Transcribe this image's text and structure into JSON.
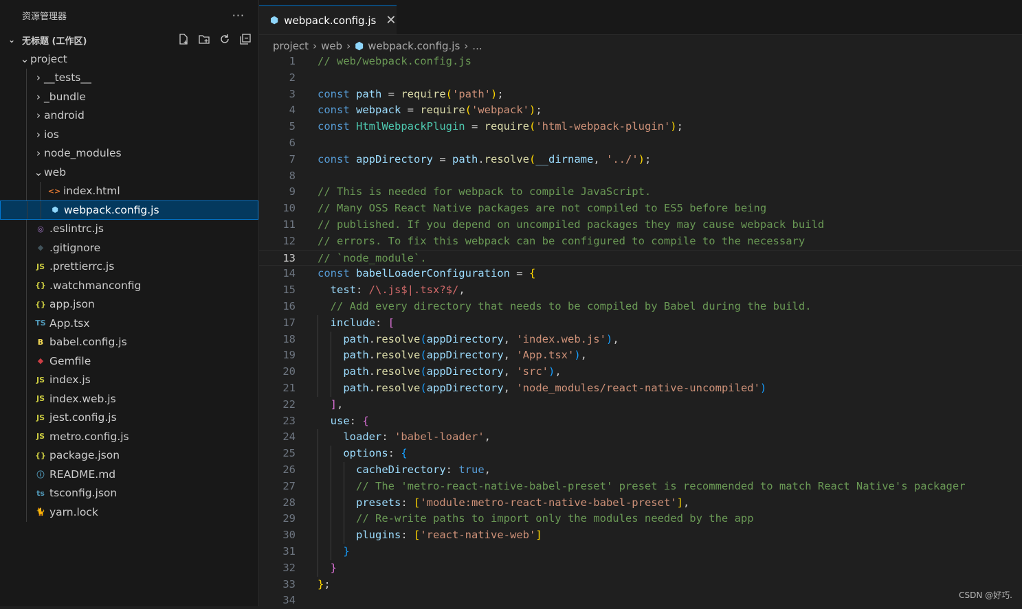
{
  "explorer": {
    "title": "资源管理器",
    "more": "···",
    "workspace": "无标题 (工作区)",
    "tree": [
      {
        "label": "project",
        "depth": 0,
        "type": "folder",
        "open": true,
        "icon": "chevron"
      },
      {
        "label": "__tests__",
        "depth": 1,
        "type": "folder",
        "open": false
      },
      {
        "label": "_bundle",
        "depth": 1,
        "type": "folder",
        "open": false
      },
      {
        "label": "android",
        "depth": 1,
        "type": "folder",
        "open": false
      },
      {
        "label": "ios",
        "depth": 1,
        "type": "folder",
        "open": false
      },
      {
        "label": "node_modules",
        "depth": 1,
        "type": "folder",
        "open": false
      },
      {
        "label": "web",
        "depth": 1,
        "type": "folder",
        "open": true
      },
      {
        "label": "index.html",
        "depth": 2,
        "type": "file",
        "icon": "html-icon",
        "glyph": "<>",
        "color": "#e37933"
      },
      {
        "label": "webpack.config.js",
        "depth": 2,
        "type": "file",
        "icon": "webpack-icon",
        "glyph": "⬢",
        "color": "#8ed6fb",
        "selected": true
      },
      {
        "label": ".eslintrc.js",
        "depth": 1,
        "type": "file",
        "icon": "eslint-icon",
        "glyph": "◎",
        "color": "#a074c4"
      },
      {
        "label": ".gitignore",
        "depth": 1,
        "type": "file",
        "icon": "git-icon",
        "glyph": "◆",
        "color": "#41535b"
      },
      {
        "label": ".prettierrc.js",
        "depth": 1,
        "type": "file",
        "icon": "js-icon",
        "glyph": "JS",
        "color": "#cbcb41"
      },
      {
        "label": ".watchmanconfig",
        "depth": 1,
        "type": "file",
        "icon": "json-icon",
        "glyph": "{}",
        "color": "#cbcb41"
      },
      {
        "label": "app.json",
        "depth": 1,
        "type": "file",
        "icon": "json-icon",
        "glyph": "{}",
        "color": "#cbcb41"
      },
      {
        "label": "App.tsx",
        "depth": 1,
        "type": "file",
        "icon": "ts-icon",
        "glyph": "TS",
        "color": "#519aba"
      },
      {
        "label": "babel.config.js",
        "depth": 1,
        "type": "file",
        "icon": "babel-icon",
        "glyph": "B",
        "color": "#f5da55"
      },
      {
        "label": "Gemfile",
        "depth": 1,
        "type": "file",
        "icon": "ruby-icon",
        "glyph": "◆",
        "color": "#cc3e44"
      },
      {
        "label": "index.js",
        "depth": 1,
        "type": "file",
        "icon": "js-icon",
        "glyph": "JS",
        "color": "#cbcb41"
      },
      {
        "label": "index.web.js",
        "depth": 1,
        "type": "file",
        "icon": "js-icon",
        "glyph": "JS",
        "color": "#cbcb41"
      },
      {
        "label": "jest.config.js",
        "depth": 1,
        "type": "file",
        "icon": "js-icon",
        "glyph": "JS",
        "color": "#cbcb41"
      },
      {
        "label": "metro.config.js",
        "depth": 1,
        "type": "file",
        "icon": "js-icon",
        "glyph": "JS",
        "color": "#cbcb41"
      },
      {
        "label": "package.json",
        "depth": 1,
        "type": "file",
        "icon": "json-icon",
        "glyph": "{}",
        "color": "#cbcb41"
      },
      {
        "label": "README.md",
        "depth": 1,
        "type": "file",
        "icon": "info-icon",
        "glyph": "ⓘ",
        "color": "#519aba"
      },
      {
        "label": "tsconfig.json",
        "depth": 1,
        "type": "file",
        "icon": "tsconfig-icon",
        "glyph": "ts",
        "color": "#519aba"
      },
      {
        "label": "yarn.lock",
        "depth": 1,
        "type": "file",
        "icon": "yarn-icon",
        "glyph": "🐈",
        "color": "#519aba"
      }
    ]
  },
  "tab": {
    "label": "webpack.config.js",
    "close": "✕"
  },
  "breadcrumb": [
    "project",
    "web",
    "webpack.config.js",
    "..."
  ],
  "editor": {
    "active_line": 13,
    "lines": [
      [
        [
          "c",
          "// web/webpack.config.js"
        ]
      ],
      [],
      [
        [
          "k",
          "const "
        ],
        [
          "v",
          "path"
        ],
        [
          "p",
          " = "
        ],
        [
          "f",
          "require"
        ],
        [
          "b1",
          "("
        ],
        [
          "s",
          "'path'"
        ],
        [
          "b1",
          ")"
        ],
        [
          "p",
          ";"
        ]
      ],
      [
        [
          "k",
          "const "
        ],
        [
          "v",
          "webpack"
        ],
        [
          "p",
          " = "
        ],
        [
          "f",
          "require"
        ],
        [
          "b1",
          "("
        ],
        [
          "s",
          "'webpack'"
        ],
        [
          "b1",
          ")"
        ],
        [
          "p",
          ";"
        ]
      ],
      [
        [
          "k",
          "const "
        ],
        [
          "cl",
          "HtmlWebpackPlugin"
        ],
        [
          "p",
          " = "
        ],
        [
          "f",
          "require"
        ],
        [
          "b1",
          "("
        ],
        [
          "s",
          "'html-webpack-plugin'"
        ],
        [
          "b1",
          ")"
        ],
        [
          "p",
          ";"
        ]
      ],
      [],
      [
        [
          "k",
          "const "
        ],
        [
          "v",
          "appDirectory"
        ],
        [
          "p",
          " = "
        ],
        [
          "v",
          "path"
        ],
        [
          "p",
          "."
        ],
        [
          "f",
          "resolve"
        ],
        [
          "b1",
          "("
        ],
        [
          "v",
          "__dirname"
        ],
        [
          "p",
          ", "
        ],
        [
          "s",
          "'../'"
        ],
        [
          "b1",
          ")"
        ],
        [
          "p",
          ";"
        ]
      ],
      [],
      [
        [
          "c",
          "// This is needed for webpack to compile JavaScript."
        ]
      ],
      [
        [
          "c",
          "// Many OSS React Native packages are not compiled to ES5 before being"
        ]
      ],
      [
        [
          "c",
          "// published. If you depend on uncompiled packages they may cause webpack build"
        ]
      ],
      [
        [
          "c",
          "// errors. To fix this webpack can be configured to compile to the necessary"
        ]
      ],
      [
        [
          "c",
          "// `node_module`."
        ]
      ],
      [
        [
          "k",
          "const "
        ],
        [
          "v",
          "babelLoaderConfiguration"
        ],
        [
          "p",
          " = "
        ],
        [
          "b1",
          "{"
        ]
      ],
      [
        [
          "p",
          "  "
        ],
        [
          "pr",
          "test"
        ],
        [
          "p",
          ": "
        ],
        [
          "r",
          "/\\.js$|.tsx?$/"
        ],
        [
          "p",
          ","
        ]
      ],
      [
        [
          "p",
          "  "
        ],
        [
          "c",
          "// Add every directory that needs to be compiled by Babel during the build."
        ]
      ],
      [
        [
          "p",
          "  "
        ],
        [
          "pr",
          "include"
        ],
        [
          "p",
          ": "
        ],
        [
          "b2",
          "["
        ]
      ],
      [
        [
          "p",
          "    "
        ],
        [
          "v",
          "path"
        ],
        [
          "p",
          "."
        ],
        [
          "f",
          "resolve"
        ],
        [
          "b3",
          "("
        ],
        [
          "v",
          "appDirectory"
        ],
        [
          "p",
          ", "
        ],
        [
          "s",
          "'index.web.js'"
        ],
        [
          "b3",
          ")"
        ],
        [
          "p",
          ","
        ]
      ],
      [
        [
          "p",
          "    "
        ],
        [
          "v",
          "path"
        ],
        [
          "p",
          "."
        ],
        [
          "f",
          "resolve"
        ],
        [
          "b3",
          "("
        ],
        [
          "v",
          "appDirectory"
        ],
        [
          "p",
          ", "
        ],
        [
          "s",
          "'App.tsx'"
        ],
        [
          "b3",
          ")"
        ],
        [
          "p",
          ","
        ]
      ],
      [
        [
          "p",
          "    "
        ],
        [
          "v",
          "path"
        ],
        [
          "p",
          "."
        ],
        [
          "f",
          "resolve"
        ],
        [
          "b3",
          "("
        ],
        [
          "v",
          "appDirectory"
        ],
        [
          "p",
          ", "
        ],
        [
          "s",
          "'src'"
        ],
        [
          "b3",
          ")"
        ],
        [
          "p",
          ","
        ]
      ],
      [
        [
          "p",
          "    "
        ],
        [
          "v",
          "path"
        ],
        [
          "p",
          "."
        ],
        [
          "f",
          "resolve"
        ],
        [
          "b3",
          "("
        ],
        [
          "v",
          "appDirectory"
        ],
        [
          "p",
          ", "
        ],
        [
          "s",
          "'node_modules/react-native-uncompiled'"
        ],
        [
          "b3",
          ")"
        ]
      ],
      [
        [
          "p",
          "  "
        ],
        [
          "b2",
          "]"
        ],
        [
          "p",
          ","
        ]
      ],
      [
        [
          "p",
          "  "
        ],
        [
          "pr",
          "use"
        ],
        [
          "p",
          ": "
        ],
        [
          "b2",
          "{"
        ]
      ],
      [
        [
          "p",
          "    "
        ],
        [
          "pr",
          "loader"
        ],
        [
          "p",
          ": "
        ],
        [
          "s",
          "'babel-loader'"
        ],
        [
          "p",
          ","
        ]
      ],
      [
        [
          "p",
          "    "
        ],
        [
          "pr",
          "options"
        ],
        [
          "p",
          ": "
        ],
        [
          "b3",
          "{"
        ]
      ],
      [
        [
          "p",
          "      "
        ],
        [
          "pr",
          "cacheDirectory"
        ],
        [
          "p",
          ": "
        ],
        [
          "k",
          "true"
        ],
        [
          "p",
          ","
        ]
      ],
      [
        [
          "p",
          "      "
        ],
        [
          "c",
          "// The 'metro-react-native-babel-preset' preset is recommended to match React Native's packager"
        ]
      ],
      [
        [
          "p",
          "      "
        ],
        [
          "pr",
          "presets"
        ],
        [
          "p",
          ": "
        ],
        [
          "b1",
          "["
        ],
        [
          "s",
          "'module:metro-react-native-babel-preset'"
        ],
        [
          "b1",
          "]"
        ],
        [
          "p",
          ","
        ]
      ],
      [
        [
          "p",
          "      "
        ],
        [
          "c",
          "// Re-write paths to import only the modules needed by the app"
        ]
      ],
      [
        [
          "p",
          "      "
        ],
        [
          "pr",
          "plugins"
        ],
        [
          "p",
          ": "
        ],
        [
          "b1",
          "["
        ],
        [
          "s",
          "'react-native-web'"
        ],
        [
          "b1",
          "]"
        ]
      ],
      [
        [
          "p",
          "    "
        ],
        [
          "b3",
          "}"
        ]
      ],
      [
        [
          "p",
          "  "
        ],
        [
          "b2",
          "}"
        ]
      ],
      [
        [
          "b1",
          "}"
        ],
        [
          "p",
          ";"
        ]
      ],
      []
    ]
  },
  "colors": {
    "c": "#6a9955",
    "k": "#569cd6",
    "v": "#9cdcfe",
    "f": "#dcdcaa",
    "s": "#ce9178",
    "p": "#cccccc",
    "cl": "#4ec9b0",
    "pr": "#9cdcfe",
    "r": "#d16969",
    "b1": "#ffd700",
    "b2": "#da70d6",
    "b3": "#179fff"
  },
  "watermark": "CSDN @好巧."
}
